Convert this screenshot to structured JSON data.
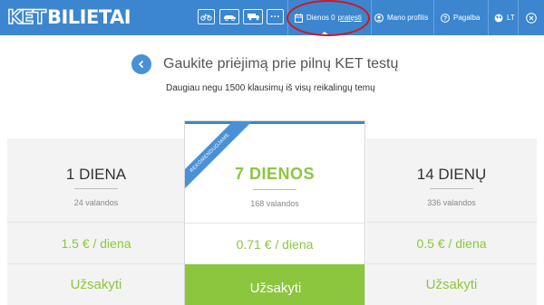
{
  "brand": {
    "logo_prefix": "KET",
    "logo_suffix": "BILIETAI"
  },
  "topbar": {
    "vehicle_categories": [
      "moto-icon",
      "car-icon",
      "truck-icon",
      "more-icon"
    ],
    "more_label": "...",
    "days_prefix": "Dienos 0",
    "days_extend": "pratęsti",
    "profile": "Mano profilis",
    "help": "Pagalba",
    "language": "LT"
  },
  "header": {
    "title": "Gaukite priėjimą prie pilnų KET testų",
    "subtitle": "Daugiau negu 1500 klausimų iš visų reikalingų temų"
  },
  "plans": [
    {
      "name": "1 DIENA",
      "hours": "24 valandos",
      "price": "1.5 € / diena",
      "order": "Užsakyti"
    },
    {
      "name": "7 DIENOS",
      "hours": "168 valandos",
      "price": "0.71 € / diena",
      "order": "Užsakyti",
      "ribbon": "REKOMENDUOJAME"
    },
    {
      "name": "14 DIENŲ",
      "hours": "336 valandos",
      "price": "0.5 € / diena",
      "order": "Užsakyti"
    }
  ],
  "colors": {
    "primary": "#3b86cf",
    "accent_green": "#8cc63f",
    "highlight": "#d8141b"
  }
}
